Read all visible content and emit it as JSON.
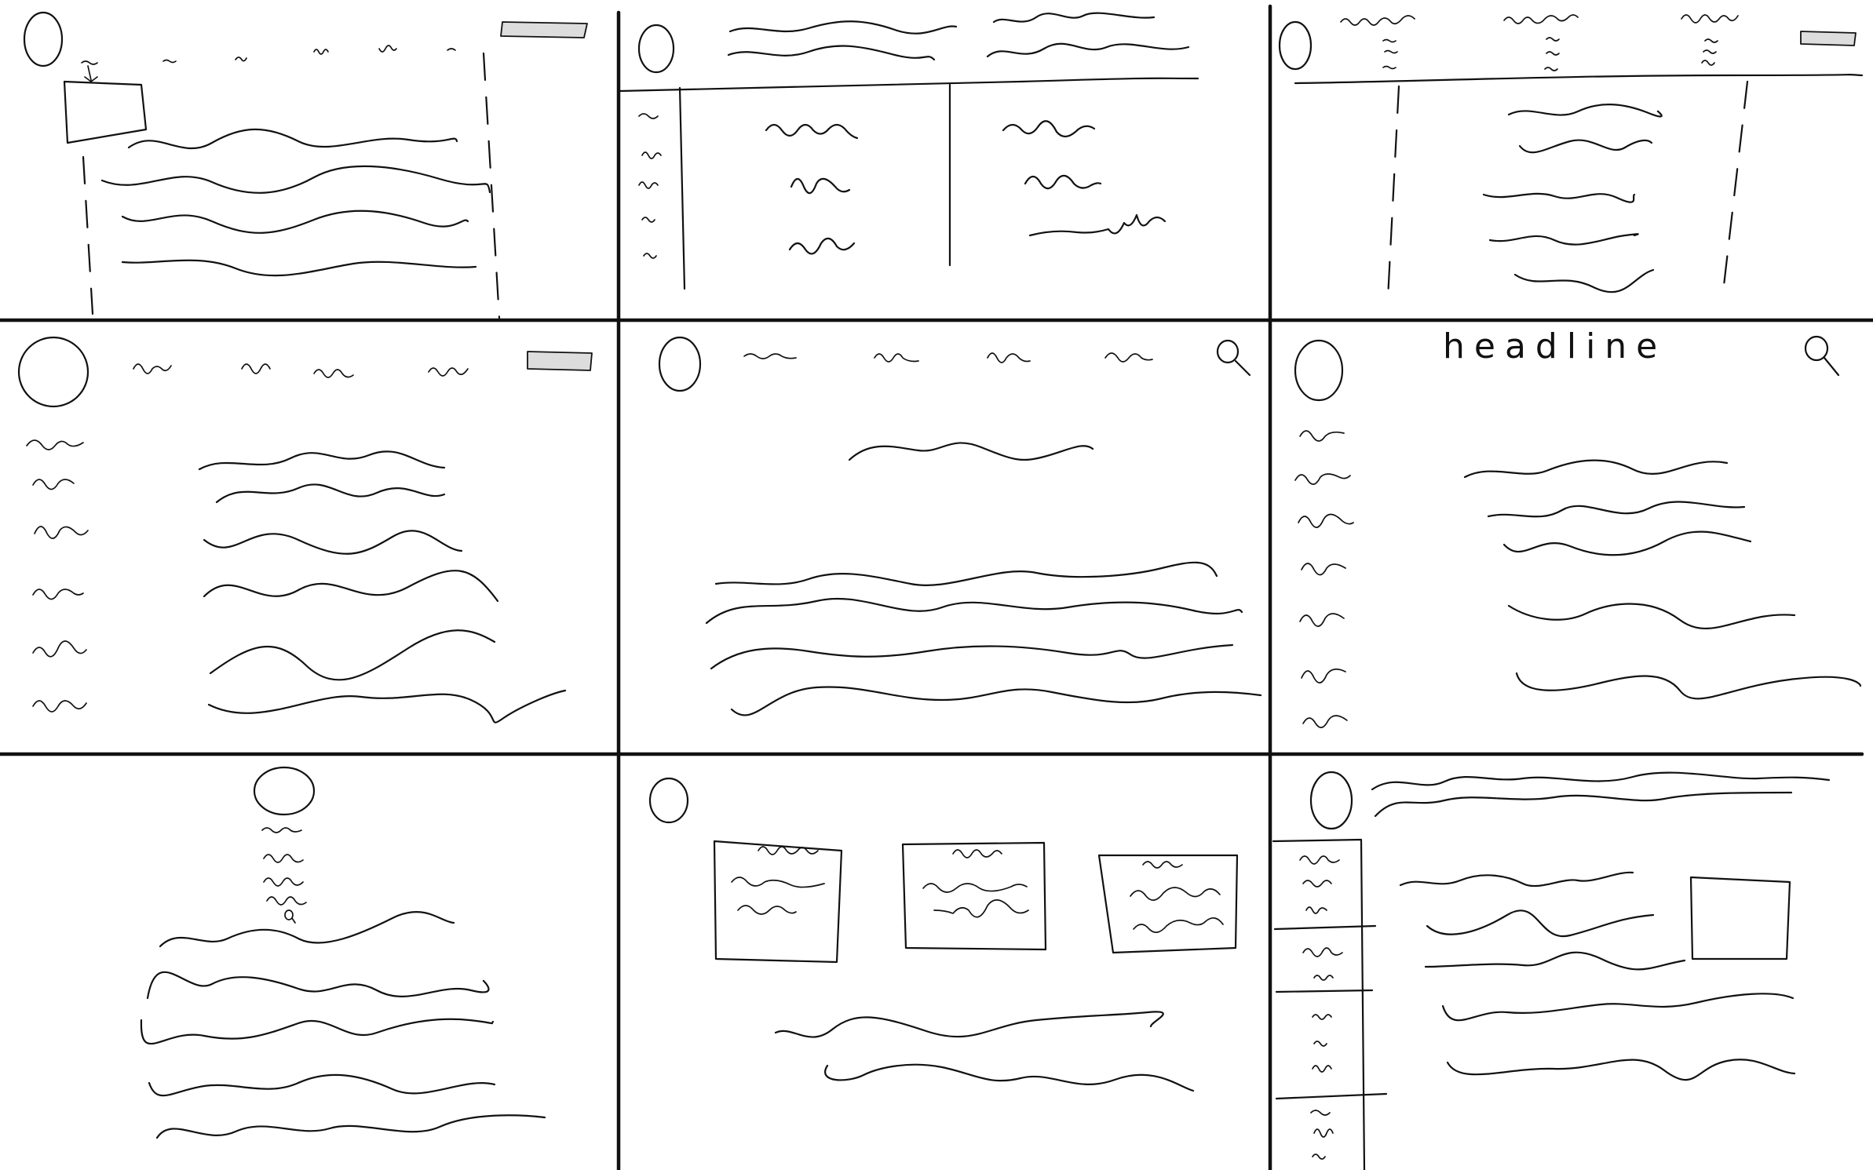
{
  "canvas": {
    "ink_color": "#111111",
    "background": "#ffffff",
    "button_fill": "#dddddd"
  },
  "panels": [
    {
      "id": "top-left",
      "elements": [
        "logo-circle",
        "nav-scribbles",
        "header-button",
        "image-box",
        "text-lines",
        "dashed-column-guides"
      ]
    },
    {
      "id": "top-center",
      "elements": [
        "logo-circle",
        "header-text",
        "table-rules",
        "table-cells"
      ]
    },
    {
      "id": "top-right",
      "elements": [
        "logo-circle",
        "column-headings",
        "header-button",
        "centered-text-lines",
        "dashed-column-guides"
      ]
    },
    {
      "id": "middle-left",
      "elements": [
        "logo-circle",
        "nav-scribbles",
        "header-button",
        "sidebar-items",
        "text-lines"
      ]
    },
    {
      "id": "middle-center",
      "elements": [
        "logo-circle",
        "nav-scribbles",
        "search-icon",
        "subtitle-line",
        "body-text-lines"
      ]
    },
    {
      "id": "middle-right",
      "elements": [
        "logo-circle",
        "headline-word",
        "search-icon",
        "sidebar-items",
        "text-lines"
      ]
    },
    {
      "id": "bottom-left",
      "elements": [
        "centered-logo-circle",
        "stacked-nav-scribbles",
        "search-icon",
        "body-text-lines"
      ]
    },
    {
      "id": "bottom-center",
      "elements": [
        "logo-circle",
        "three-cards",
        "body-text-lines"
      ]
    },
    {
      "id": "bottom-right",
      "elements": [
        "logo-circle",
        "header-text",
        "sectioned-sidebar",
        "text-lines",
        "image-box"
      ]
    }
  ],
  "headline": {
    "text": "headline"
  },
  "icons": [
    "search-icon"
  ]
}
